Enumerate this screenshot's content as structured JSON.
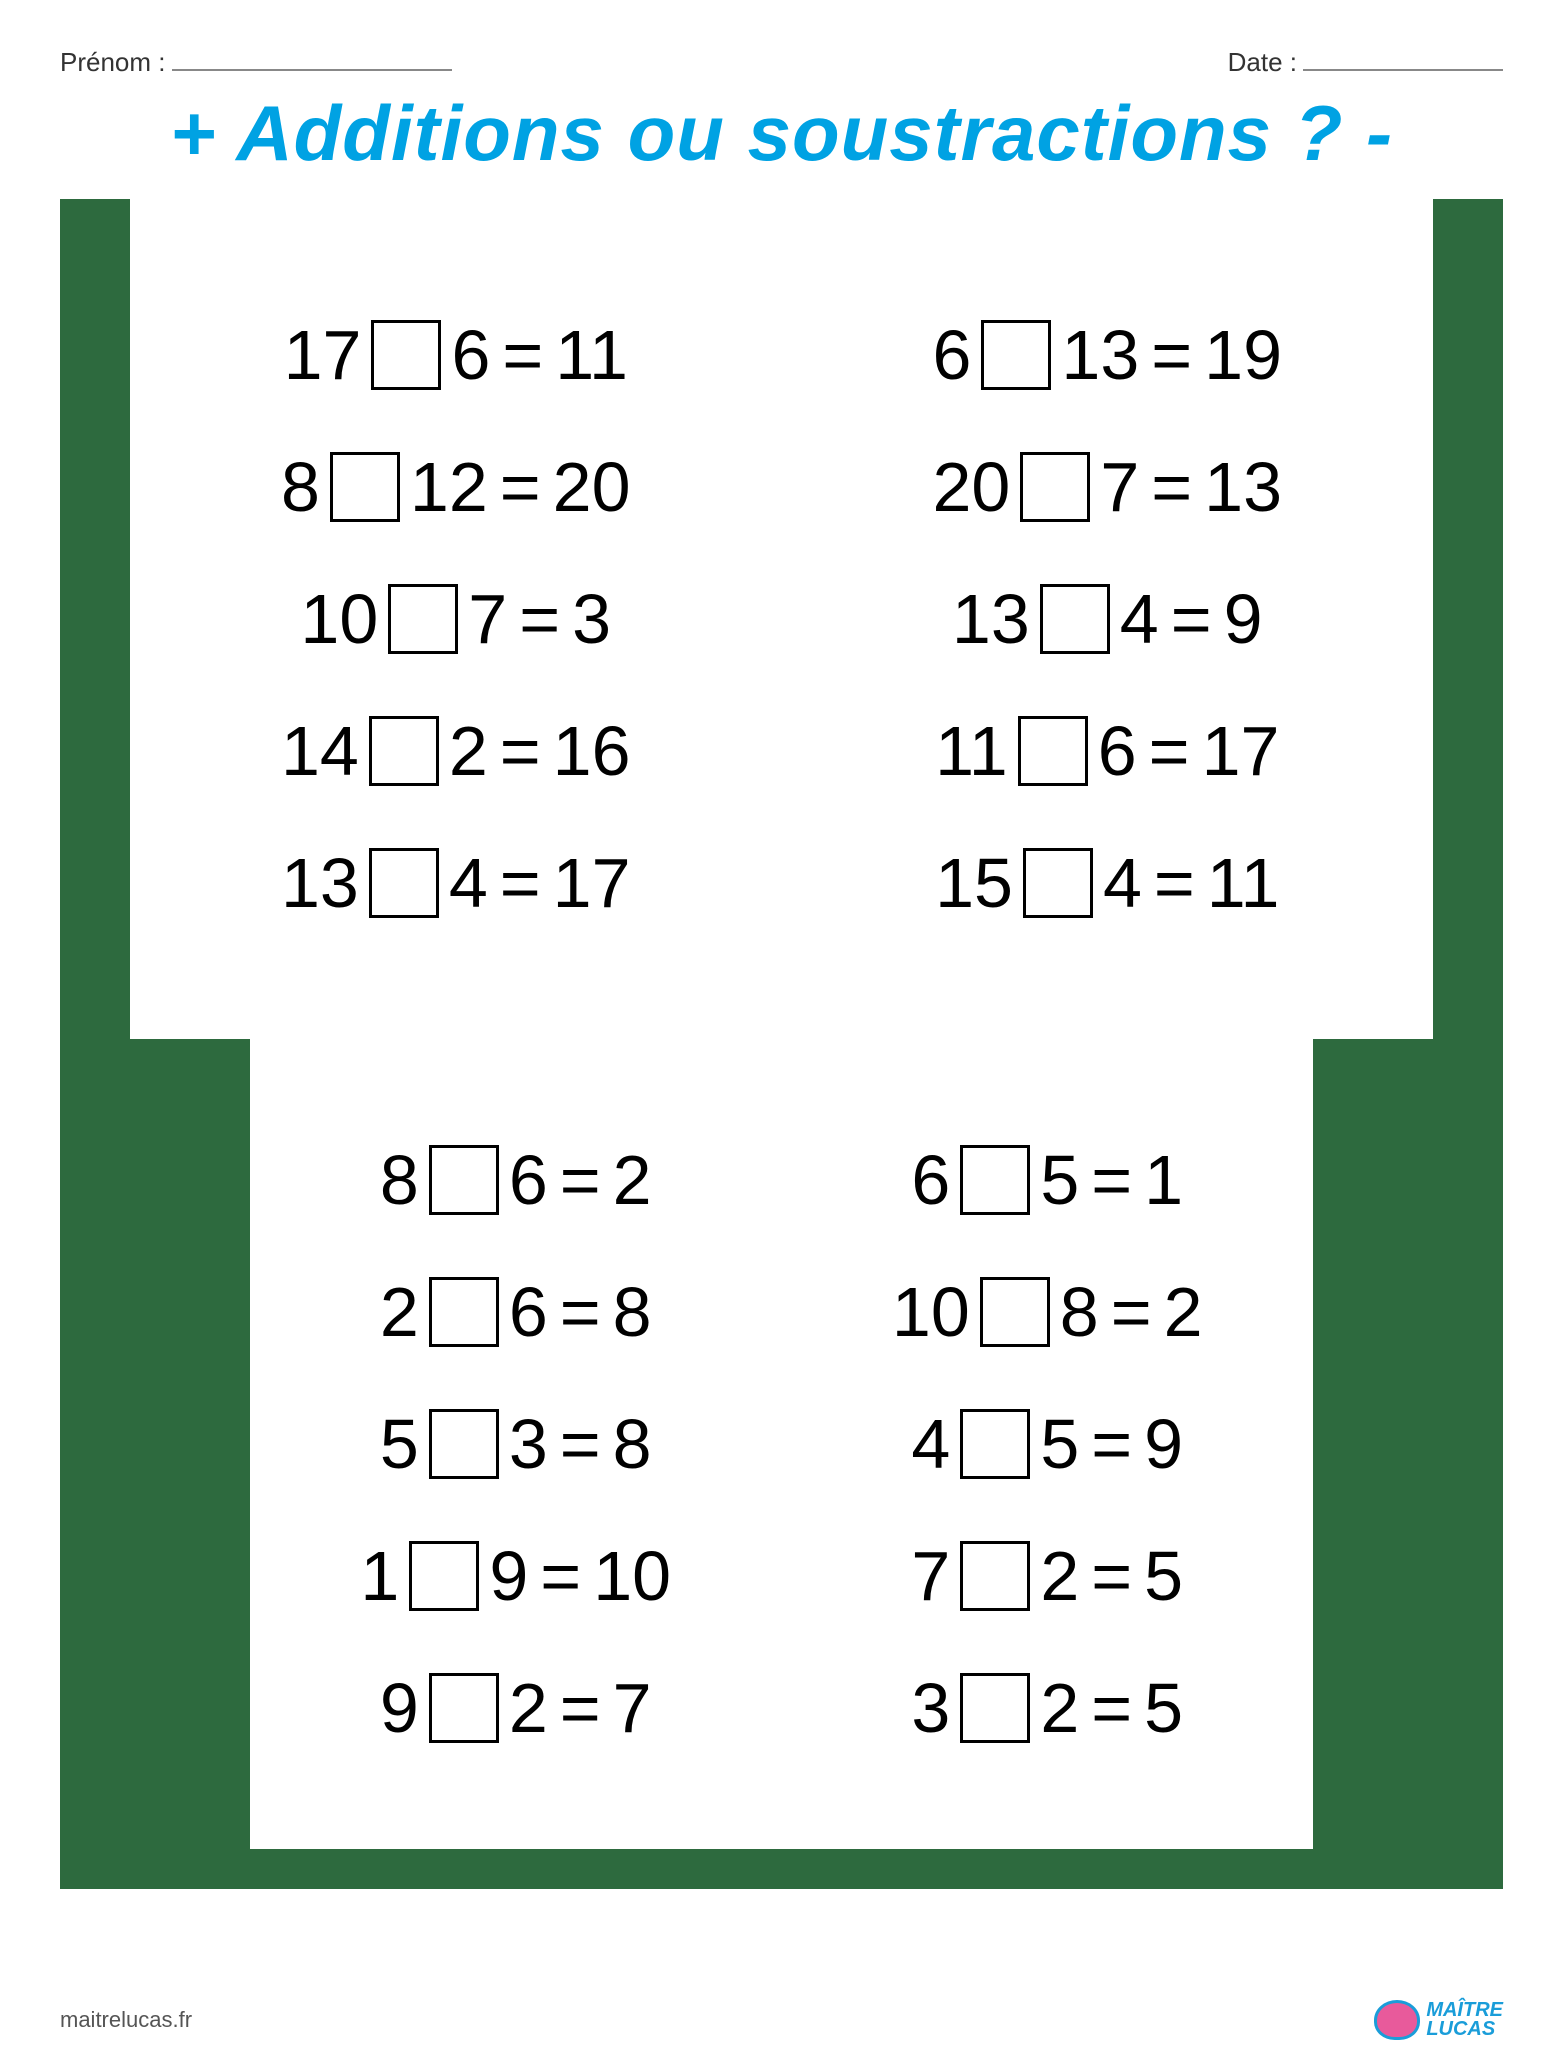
{
  "header": {
    "name_label": "Prénom :",
    "date_label": "Date :"
  },
  "title": "+ Additions ou soustractions ? -",
  "panels": [
    {
      "rows": [
        [
          {
            "a": "17",
            "b": "6",
            "r": "11"
          },
          {
            "a": "6",
            "b": "13",
            "r": "19"
          }
        ],
        [
          {
            "a": "8",
            "b": "12",
            "r": "20"
          },
          {
            "a": "20",
            "b": "7",
            "r": "13"
          }
        ],
        [
          {
            "a": "10",
            "b": "7",
            "r": "3"
          },
          {
            "a": "13",
            "b": "4",
            "r": "9"
          }
        ],
        [
          {
            "a": "14",
            "b": "2",
            "r": "16"
          },
          {
            "a": "11",
            "b": "6",
            "r": "17"
          }
        ],
        [
          {
            "a": "13",
            "b": "4",
            "r": "17"
          },
          {
            "a": "15",
            "b": "4",
            "r": "11"
          }
        ]
      ]
    },
    {
      "rows": [
        [
          {
            "a": "8",
            "b": "6",
            "r": "2"
          },
          {
            "a": "6",
            "b": "5",
            "r": "1"
          }
        ],
        [
          {
            "a": "2",
            "b": "6",
            "r": "8"
          },
          {
            "a": "10",
            "b": "8",
            "r": "2"
          }
        ],
        [
          {
            "a": "5",
            "b": "3",
            "r": "8"
          },
          {
            "a": "4",
            "b": "5",
            "r": "9"
          }
        ],
        [
          {
            "a": "1",
            "b": "9",
            "r": "10"
          },
          {
            "a": "7",
            "b": "2",
            "r": "5"
          }
        ],
        [
          {
            "a": "9",
            "b": "2",
            "r": "7"
          },
          {
            "a": "3",
            "b": "2",
            "r": "5"
          }
        ]
      ]
    }
  ],
  "footer": {
    "url": "maitrelucas.fr",
    "logo_line1": "MAÎTRE",
    "logo_line2": "LUCAS"
  }
}
